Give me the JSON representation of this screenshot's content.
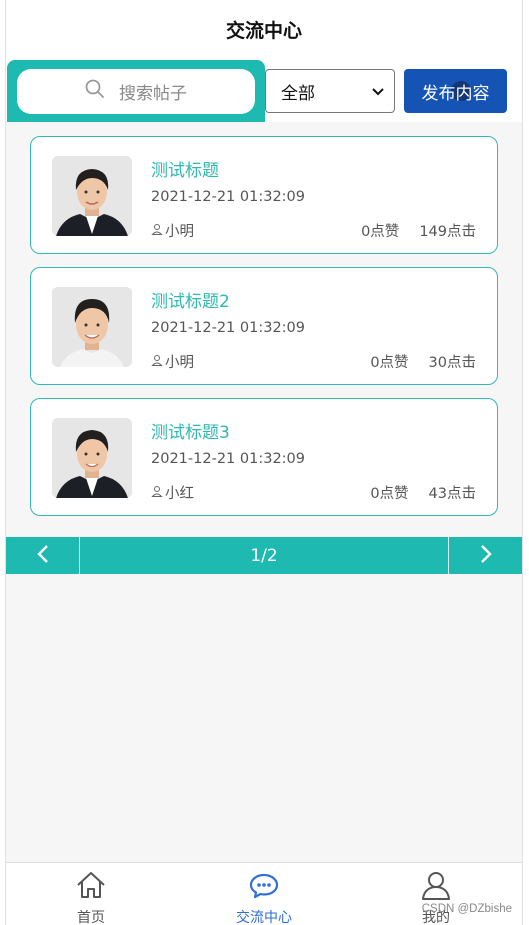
{
  "header": {
    "title": "交流中心"
  },
  "search": {
    "placeholder": "搜索帖子"
  },
  "filter": {
    "selected": "全部"
  },
  "toolbar": {
    "publish_label": "发布内容"
  },
  "posts": [
    {
      "title": "测试标题",
      "time": "2021-12-21 01:32:09",
      "author": "小明",
      "likes": "0点赞",
      "clicks": "149点击"
    },
    {
      "title": "测试标题2",
      "time": "2021-12-21 01:32:09",
      "author": "小明",
      "likes": "0点赞",
      "clicks": "30点击"
    },
    {
      "title": "测试标题3",
      "time": "2021-12-21 01:32:09",
      "author": "小红",
      "likes": "0点赞",
      "clicks": "43点击"
    }
  ],
  "pagination": {
    "indicator": "1/2"
  },
  "tabbar": {
    "items": [
      {
        "label": "首页",
        "icon": "home-icon"
      },
      {
        "label": "交流中心",
        "icon": "chat-icon",
        "active": true
      },
      {
        "label": "我的",
        "icon": "user-icon"
      }
    ]
  },
  "watermark": "CSDN @DZbishe",
  "colors": {
    "accent": "#1ebab2",
    "primary_button": "#1554b4",
    "title_link": "#2fb8b0",
    "active_tab": "#2f6fd6"
  }
}
